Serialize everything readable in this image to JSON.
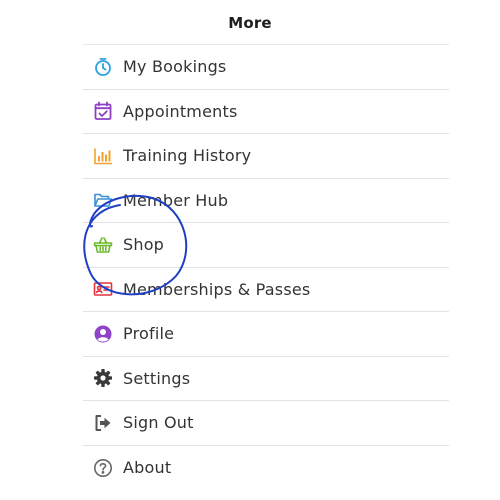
{
  "header": {
    "title": "More"
  },
  "menu": {
    "items": [
      {
        "label": "My Bookings",
        "icon": "timer-icon",
        "icon_color": "#29a3e0"
      },
      {
        "label": "Appointments",
        "icon": "calendar-check-icon",
        "icon_color": "#8e3fc4"
      },
      {
        "label": "Training History",
        "icon": "bar-chart-icon",
        "icon_color": "#f2a12e"
      },
      {
        "label": "Member Hub",
        "icon": "folder-open-icon",
        "icon_color": "#3b8fd9"
      },
      {
        "label": "Shop",
        "icon": "shopping-basket-icon",
        "icon_color": "#6bb82a"
      },
      {
        "label": "Memberships & Passes",
        "icon": "membership-card-icon",
        "icon_color": "#e0353d"
      },
      {
        "label": "Profile",
        "icon": "user-circle-icon",
        "icon_color": "#8e44c9"
      },
      {
        "label": "Settings",
        "icon": "gear-icon",
        "icon_color": "#3a3a3a"
      },
      {
        "label": "Sign Out",
        "icon": "sign-out-icon",
        "icon_color": "#555555"
      },
      {
        "label": "About",
        "icon": "question-circle-icon",
        "icon_color": "#666666"
      }
    ]
  },
  "annotation": {
    "type": "hand-drawn-circle",
    "target": "Shop",
    "color": "#1f3fc4"
  }
}
